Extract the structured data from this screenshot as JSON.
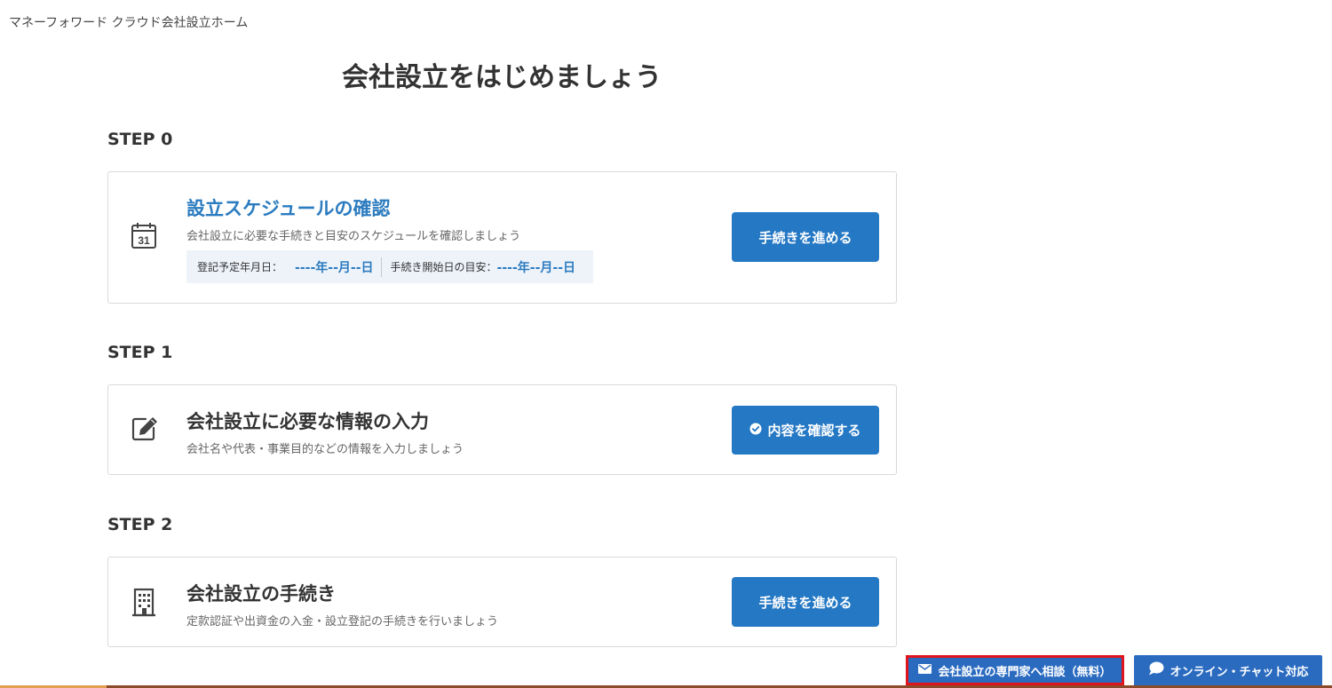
{
  "breadcrumb": "マネーフォワード クラウド会社設立ホーム",
  "page_title": "会社設立をはじめましょう",
  "steps": [
    {
      "label": "STEP 0",
      "title": "設立スケジュールの確認",
      "description": "会社設立に必要な手続きと目安のスケジュールを確認しましょう",
      "icon": "calendar-icon",
      "icon_text": "31",
      "schedule": {
        "registration_label": "登記予定年月日：",
        "registration_value": "----年--月--日",
        "start_label": "手続き開始日の目安：",
        "start_value": "----年--月--日"
      },
      "button_label": "手続きを進める"
    },
    {
      "label": "STEP 1",
      "title": "会社設立に必要な情報の入力",
      "description": "会社名や代表・事業目的などの情報を入力しましょう",
      "icon": "edit-icon",
      "button_label": "内容を確認する",
      "button_icon": "check-circle-icon"
    },
    {
      "label": "STEP 2",
      "title": "会社設立の手続き",
      "description": "定款認証や出資金の入金・設立登記の手続きを行いましょう",
      "icon": "building-icon",
      "button_label": "手続きを進める"
    }
  ],
  "footer": {
    "consult_label": "会社設立の専門家へ相談（無料）",
    "consult_icon": "mail-icon",
    "chat_label": "オンライン・チャット対応",
    "chat_icon": "chat-bubble-icon"
  },
  "colors": {
    "primary": "#2578c4",
    "link": "#2b7bbf",
    "highlight_border": "#e0141d",
    "schedule_bg": "#eef3fa"
  }
}
